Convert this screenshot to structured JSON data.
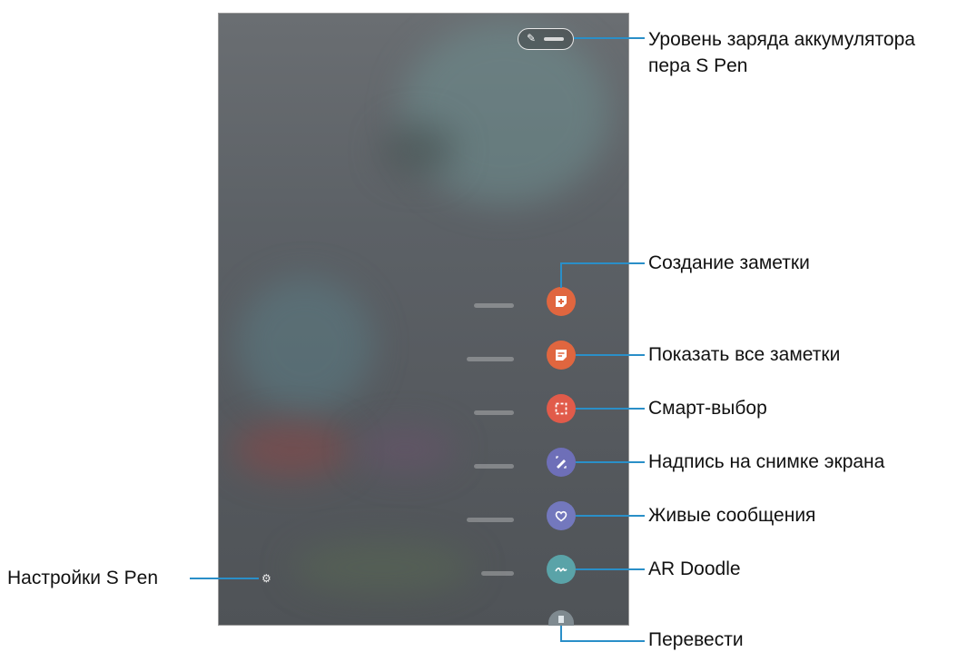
{
  "callouts": {
    "battery_line1": "Уровень заряда аккумулятора",
    "battery_line2": "пера S Pen",
    "create_note": "Создание заметки",
    "view_all_notes": "Показать все заметки",
    "smart_select": "Смарт-выбор",
    "screen_write": "Надпись на снимке экрана",
    "live_messages": "Живые сообщения",
    "ar_doodle": "AR Doodle",
    "translate": "Перевести",
    "settings": "Настройки S Pen"
  },
  "colors": {
    "create_note": "#e0663f",
    "view_all_notes": "#e0663f",
    "smart_select": "#e15b4a",
    "screen_write": "#6e6fb8",
    "live_messages": "#7378bd",
    "ar_doodle": "#5aa3a8",
    "callout_line": "#2a8fc8"
  },
  "icons": {
    "battery": "pen-battery-icon",
    "create_note": "note-plus-icon",
    "view_all_notes": "notes-list-icon",
    "smart_select": "dashed-select-icon",
    "screen_write": "pen-write-icon",
    "live_messages": "heart-message-icon",
    "ar_doodle": "doodle-icon",
    "translate": "translate-icon",
    "settings": "gear-icon"
  }
}
